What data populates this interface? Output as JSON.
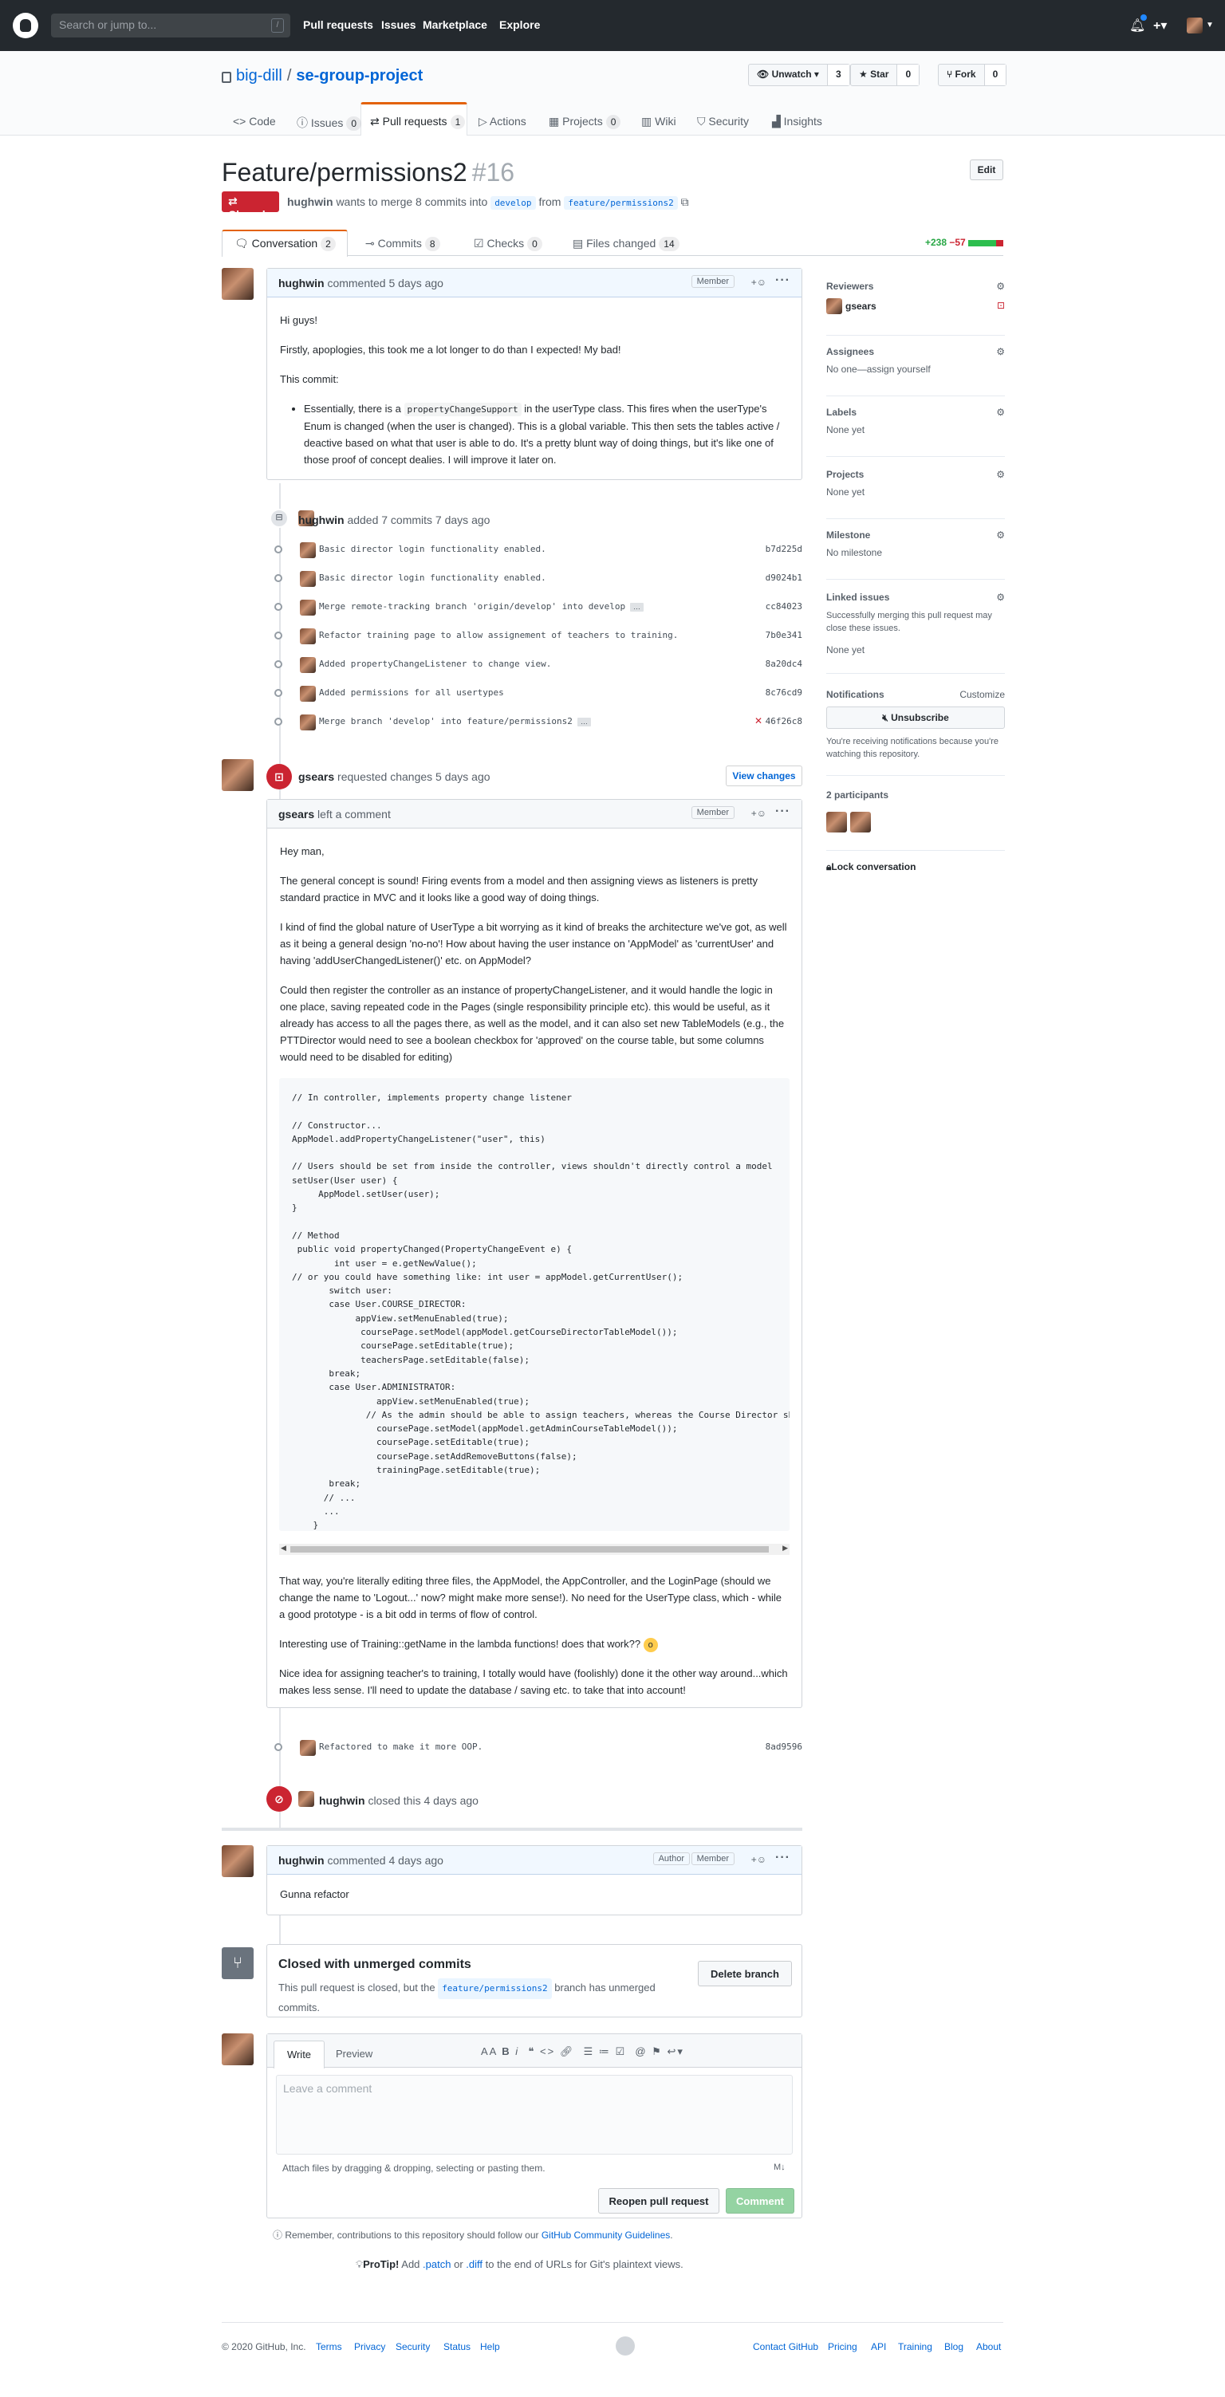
{
  "header": {
    "search_placeholder": "Search or jump to...",
    "slash": "/",
    "nav": [
      "Pull requests",
      "Issues",
      "Marketplace",
      "Explore"
    ]
  },
  "repo": {
    "owner": "big-dill",
    "name": "se-group-project",
    "unwatch_label": "Unwatch ▾",
    "watch_count": "3",
    "star_label": "Star",
    "star_count": "0",
    "fork_label": "Fork",
    "fork_count": "0",
    "tabs": {
      "code": "Code",
      "issues": "Issues",
      "issues_count": "0",
      "pulls": "Pull requests",
      "pulls_count": "1",
      "actions": "Actions",
      "projects": "Projects",
      "projects_count": "0",
      "wiki": "Wiki",
      "security": "Security",
      "insights": "Insights"
    }
  },
  "pr": {
    "title": "Feature/permissions2",
    "number": "#16",
    "edit_label": "Edit",
    "state": "Closed",
    "author": "hughwin",
    "meta_text": "wants to merge 8 commits into",
    "base_branch": "develop",
    "from_text": "from",
    "head_branch": "feature/permissions2",
    "tabs": {
      "conversation": "Conversation",
      "conversation_count": "2",
      "commits": "Commits",
      "commits_count": "8",
      "checks": "Checks",
      "checks_count": "0",
      "files": "Files changed",
      "files_count": "14"
    },
    "additions": "+238",
    "deletions": "−57"
  },
  "comment1": {
    "author": "hughwin",
    "action": "commented 5 days ago",
    "badge": "Member",
    "p1": "Hi guys!",
    "p2": "Firstly, apoplogies, this took me a lot longer to do than I expected! My bad!",
    "p3": "This commit:",
    "li_pre": "Essentially, there is a",
    "li_code": "propertyChangeSupport",
    "li_post": "in the userType class. This fires when the userType's Enum is changed (when the user is changed). This is a global variable. This then sets the tables active / deactive based on what that user is able to do. It's a pretty blunt way of doing things, but it's like one of those proof of concept dealies. I will improve it later on."
  },
  "commits_event": {
    "author": "hughwin",
    "text": "added 7 commits 7 days ago"
  },
  "commits": [
    {
      "msg": "Basic director login functionality enabled.",
      "sha": "b7d225d",
      "ellipsis": "",
      "fail": ""
    },
    {
      "msg": "Basic director login functionality enabled.",
      "sha": "d9024b1",
      "ellipsis": "",
      "fail": ""
    },
    {
      "msg": "Merge remote-tracking branch 'origin/develop' into develop",
      "sha": "cc84023",
      "ellipsis": "…",
      "fail": ""
    },
    {
      "msg": "Refactor training page to allow assignement of teachers to training.",
      "sha": "7b0e341",
      "ellipsis": "",
      "fail": ""
    },
    {
      "msg": "Added propertyChangeListener to change view.",
      "sha": "8a20dc4",
      "ellipsis": "",
      "fail": ""
    },
    {
      "msg": "Added permissions for all usertypes",
      "sha": "8c76cd9",
      "ellipsis": "",
      "fail": ""
    },
    {
      "msg": "Merge branch 'develop' into feature/permissions2",
      "sha": "46f26c8",
      "ellipsis": "…",
      "fail": "✕"
    }
  ],
  "review": {
    "author": "gsears",
    "text": "requested changes 5 days ago",
    "view_changes": "View changes",
    "comment_author": "gsears",
    "comment_action": "left a comment",
    "badge": "Member",
    "p1": "Hey man,",
    "p2": "The general concept is sound! Firing events from a model and then assigning views as listeners is pretty standard practice in MVC and it looks like a good way of doing things.",
    "p3": "I kind of find the global nature of UserType a bit worrying as it kind of breaks the architecture we've got, as well as it being a general design 'no-no'! How about having the user instance on 'AppModel' as 'currentUser' and having 'addUserChangedListener()' etc. on AppModel?",
    "p4": "Could then register the controller as an instance of propertyChangeListener, and it would handle the logic in one place, saving repeated code in the Pages (single responsibility principle etc). this would be useful, as it already has access to all the pages there, as well as the model, and it can also set new TableModels (e.g., the PTTDirector would need to see a boolean checkbox for 'approved' on the course table, but some columns would need to be disabled for editing)",
    "code": "// In controller, implements property change listener\n\n// Constructor...\nAppModel.addPropertyChangeListener(\"user\", this)\n\n// Users should be set from inside the controller, views shouldn't directly control a model\nsetUser(User user) {\n     AppModel.setUser(user);\n}\n\n// Method\n public void propertyChanged(PropertyChangeEvent e) {\n        int user = e.getNewValue();\n// or you could have something like: int user = appModel.getCurrentUser();\n       switch user:\n       case User.COURSE_DIRECTOR:\n            appView.setMenuEnabled(true);\n             coursePage.setModel(appModel.getCourseDirectorTableModel());\n             coursePage.setEditable(true);\n             teachersPage.setEditable(false);\n       break;\n       case User.ADMINISTRATOR:\n                appView.setMenuEnabled(true);\n              // As the admin should be able to assign teachers, whereas the Course Director shou\n                coursePage.setModel(appModel.getAdminCourseTableModel());\n                coursePage.setEditable(true);\n                coursePage.setAddRemoveButtons(false);\n                trainingPage.setEditable(true);\n       break;\n      // ...\n      ...\n    }",
    "p5": "That way, you're literally editing three files, the AppModel, the AppController, and the LoginPage (should we change the name to 'Logout...' now? might make more sense!). No need for the UserType class, which - while a good prototype - is a bit odd in terms of flow of control.",
    "p6": "Interesting use of Training::getName in the lambda functions! does that work??",
    "p7": "Nice idea for assigning teacher's to training, I totally would have (foolishly) done it the other way around...which makes less sense. I'll need to update the database / saving etc. to take that into account!"
  },
  "late_commit": {
    "msg": "Refactored to make it more OOP.",
    "sha": "8ad9596"
  },
  "closed_event": {
    "author": "hughwin",
    "text": "closed this 4 days ago"
  },
  "comment2": {
    "author": "hughwin",
    "action": "commented 4 days ago",
    "badge_author": "Author",
    "badge_member": "Member",
    "body": "Gunna refactor"
  },
  "merge_box": {
    "title": "Closed with unmerged commits",
    "text_pre": "This pull request is closed, but the",
    "branch": "feature/permissions2",
    "text_post": "branch has unmerged commits.",
    "delete_label": "Delete branch"
  },
  "composer": {
    "tab_write": "Write",
    "tab_preview": "Preview",
    "placeholder": "Leave a comment",
    "attach_text": "Attach files by dragging & dropping, selecting or pasting them.",
    "reopen_label": "Reopen pull request",
    "comment_label": "Comment"
  },
  "guidelines": {
    "pre": "Remember, contributions to this repository should follow our",
    "link": "GitHub Community Guidelines",
    "post": "."
  },
  "protip": {
    "label": "ProTip!",
    "pre": "Add",
    "patch": ".patch",
    "or": "or",
    "diff": ".diff",
    "post": "to the end of URLs for Git's plaintext views."
  },
  "sidebar": {
    "reviewers_h": "Reviewers",
    "reviewer": "gsears",
    "assignees_h": "Assignees",
    "assignees_v": "No one—assign yourself",
    "labels_h": "Labels",
    "labels_v": "None yet",
    "projects_h": "Projects",
    "projects_v": "None yet",
    "milestone_h": "Milestone",
    "milestone_v": "No milestone",
    "linked_h": "Linked issues",
    "linked_desc": "Successfully merging this pull request may close these issues.",
    "linked_v": "None yet",
    "notif_h": "Notifications",
    "customize": "Customize",
    "unsubscribe": "Unsubscribe",
    "notif_desc": "You're receiving notifications because you're watching this repository.",
    "participants_h": "2 participants",
    "lock": "Lock conversation"
  },
  "footer": {
    "copyright": "© 2020 GitHub, Inc.",
    "left": [
      "Terms",
      "Privacy",
      "Security",
      "Status",
      "Help"
    ],
    "right": [
      "Contact GitHub",
      "Pricing",
      "API",
      "Training",
      "Blog",
      "About"
    ]
  },
  "colors": {
    "accent": "#0366d6",
    "closed": "#cb2431",
    "added": "#28a745",
    "header": "#24292e"
  }
}
